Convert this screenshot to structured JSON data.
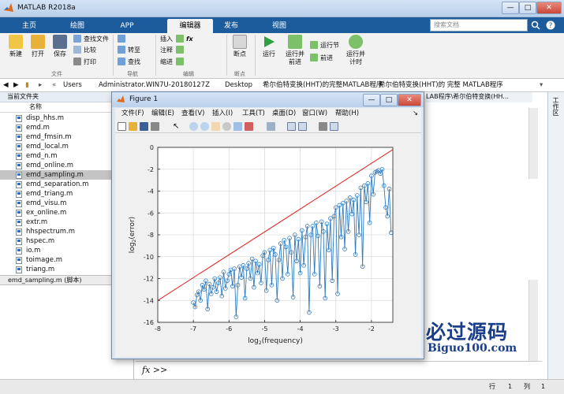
{
  "window": {
    "title": "MATLAB R2018a"
  },
  "tabs": [
    "主页",
    "绘图",
    "APP",
    "编辑器",
    "发布",
    "视图"
  ],
  "search_placeholder": "搜索文档",
  "ribbon": {
    "file": {
      "group": "文件",
      "new": "新建",
      "open": "打开",
      "save": "保存",
      "find_files": "查找文件",
      "compare": "比较",
      "print": "打印"
    },
    "nav": {
      "group": "导航",
      "goto": "转至",
      "find": "查找"
    },
    "edit": {
      "group": "编辑",
      "insert": "插入",
      "fx": "fx",
      "comment": "注释",
      "indent": "缩进"
    },
    "breakpoints": {
      "group": "断点",
      "label": "断点"
    },
    "run": {
      "run": "运行",
      "run_advance": "运行并\n前进",
      "run_section": "运行节",
      "advance": "前进",
      "run_time": "运行并\n计时"
    }
  },
  "address": {
    "parts": [
      "Users",
      "Administrator.WIN7U-20180127Z",
      "Desktop",
      "希尔伯特变换(HHT)的完整MATLAB程序",
      "希尔伯特变换(HHT)的 完整 MATLAB程序"
    ],
    "overflow": "LAB程序\\希尔伯特变换(HH..."
  },
  "current_folder": {
    "title": "当前文件夹",
    "name_header": "名称",
    "files": [
      "disp_hhs.m",
      "emd.m",
      "emd_fmsin.m",
      "emd_local.m",
      "emd_n.m",
      "emd_online.m",
      "emd_sampling.m",
      "emd_separation.m",
      "emd_triang.m",
      "emd_visu.m",
      "ex_online.m",
      "extr.m",
      "hhspectrum.m",
      "hspec.m",
      "io.m",
      "toimage.m",
      "triang.m"
    ],
    "selected": "emd_sampling.m",
    "details": "emd_sampling.m  (脚本)"
  },
  "workspace_tab": "工作区",
  "command": {
    "prompt": "fx >>"
  },
  "status": {
    "row_label": "行",
    "row": "1",
    "col_label": "列",
    "col": "1"
  },
  "figure": {
    "title": "Figure 1",
    "menu": [
      "文件(F)",
      "编辑(E)",
      "查看(V)",
      "插入(I)",
      "工具(T)",
      "桌面(D)",
      "窗口(W)",
      "帮助(H)"
    ]
  },
  "watermark": {
    "line1": "必过源码",
    "line2": "Biguo100.com"
  },
  "colors": {
    "series": "#2e7bc0",
    "reference": "#e02020",
    "ribbon_tab": "#1d5c9c"
  },
  "chart_data": {
    "type": "line",
    "xlabel": "log2(frequency)",
    "ylabel": "log2(error)",
    "xlim": [
      -8,
      -1.4
    ],
    "ylim": [
      -16,
      0
    ],
    "xticks": [
      -8,
      -7,
      -6,
      -5,
      -4,
      -3,
      -2
    ],
    "yticks": [
      0,
      -2,
      -4,
      -6,
      -8,
      -10,
      -12,
      -14,
      -16
    ],
    "grid": true,
    "series": [
      {
        "style": "line",
        "color": "#e02020",
        "x": [
          -8,
          -1.4
        ],
        "y": [
          -14,
          -0.2
        ]
      },
      {
        "style": "line-marker",
        "color": "#2e7bc0",
        "marker": "circle",
        "x": [
          -7,
          -6.95,
          -6.9,
          -6.85,
          -6.8,
          -6.75,
          -6.7,
          -6.65,
          -6.6,
          -6.55,
          -6.5,
          -6.45,
          -6.4,
          -6.35,
          -6.3,
          -6.25,
          -6.2,
          -6.15,
          -6.1,
          -6.05,
          -6.0,
          -5.95,
          -5.9,
          -5.85,
          -5.8,
          -5.75,
          -5.7,
          -5.65,
          -5.6,
          -5.55,
          -5.5,
          -5.45,
          -5.4,
          -5.35,
          -5.3,
          -5.25,
          -5.2,
          -5.15,
          -5.1,
          -5.05,
          -5.0,
          -4.95,
          -4.9,
          -4.85,
          -4.8,
          -4.75,
          -4.7,
          -4.65,
          -4.6,
          -4.55,
          -4.5,
          -4.45,
          -4.4,
          -4.35,
          -4.3,
          -4.25,
          -4.2,
          -4.15,
          -4.1,
          -4.05,
          -4.0,
          -3.95,
          -3.9,
          -3.85,
          -3.8,
          -3.75,
          -3.7,
          -3.65,
          -3.6,
          -3.55,
          -3.5,
          -3.45,
          -3.4,
          -3.35,
          -3.3,
          -3.25,
          -3.2,
          -3.15,
          -3.1,
          -3.05,
          -3.0,
          -2.95,
          -2.9,
          -2.85,
          -2.8,
          -2.75,
          -2.7,
          -2.65,
          -2.6,
          -2.55,
          -2.5,
          -2.45,
          -2.4,
          -2.35,
          -2.3,
          -2.25,
          -2.2,
          -2.15,
          -2.1,
          -2.05,
          -2.0,
          -1.95,
          -1.9,
          -1.85,
          -1.8,
          -1.75,
          -1.7,
          -1.65,
          -1.6,
          -1.55,
          -1.5,
          -1.45
        ],
        "y": [
          -14.2,
          -14.6,
          -13.5,
          -13.2,
          -14.0,
          -12.6,
          -13.0,
          -12.2,
          -14.8,
          -12.5,
          -13.4,
          -12.8,
          -12.0,
          -13.2,
          -12.4,
          -11.9,
          -13.6,
          -11.4,
          -12.9,
          -12.2,
          -11.6,
          -11.2,
          -12.7,
          -11.1,
          -15.5,
          -12.6,
          -10.9,
          -11.9,
          -10.8,
          -13.8,
          -11.1,
          -10.6,
          -12.0,
          -10.2,
          -12.8,
          -10.4,
          -11.5,
          -10.7,
          -12.4,
          -9.9,
          -9.6,
          -13.1,
          -10.3,
          -9.4,
          -12.6,
          -9.2,
          -9.8,
          -14.0,
          -10.3,
          -8.8,
          -12.0,
          -8.5,
          -9.1,
          -11.6,
          -8.3,
          -9.6,
          -13.7,
          -8.0,
          -10.4,
          -8.4,
          -11.5,
          -7.6,
          -10.8,
          -8.2,
          -7.2,
          -15.1,
          -8.0,
          -7.2,
          -11.6,
          -6.9,
          -8.1,
          -12.7,
          -6.8,
          -7.7,
          -13.8,
          -7.0,
          -9.4,
          -6.5,
          -12.2,
          -6.3,
          -5.5,
          -13.4,
          -5.3,
          -8.2,
          -5.1,
          -9.3,
          -4.9,
          -7.7,
          -4.6,
          -6.1,
          -4.8,
          -9.8,
          -4.4,
          -8.0,
          -3.7,
          -10.9,
          -3.5,
          -5.0,
          -3.3,
          -6.9,
          -2.6,
          -4.3,
          -2.3,
          -2.2,
          -2.1,
          -2.4,
          -2.0,
          -3.5,
          -5.5,
          -6.3,
          -3.8,
          -7.8
        ]
      }
    ]
  }
}
